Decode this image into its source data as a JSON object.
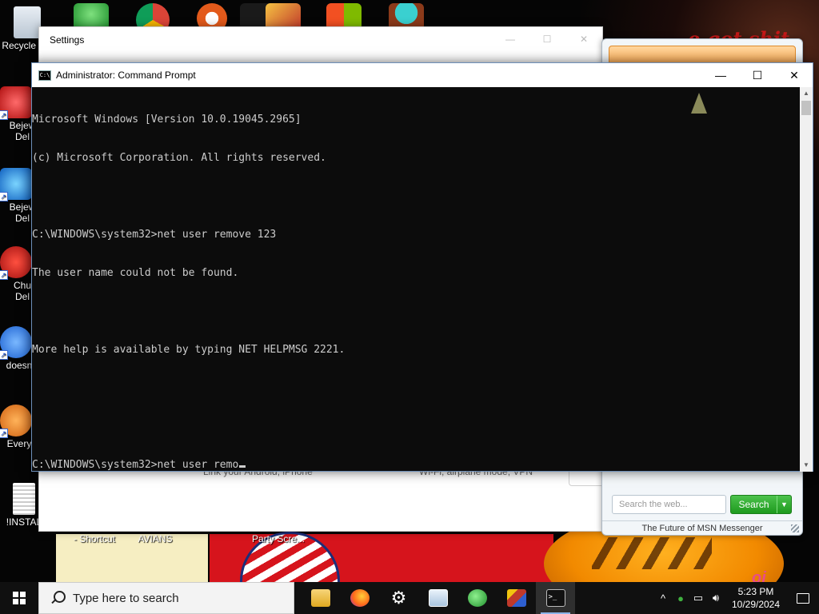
{
  "desktop": {
    "background_text_top": "e got shit",
    "icons": [
      {
        "label": "Recycle Bin",
        "name": "recycle-bin-icon"
      },
      {
        "label": "Bejew Del",
        "name": "bejeweled-icon"
      },
      {
        "label": "Bejew Del",
        "name": "bejeweled-icon"
      },
      {
        "label": "Chu Del",
        "name": "chuzzle-icon"
      },
      {
        "label": "doesn",
        "name": "app-icon"
      },
      {
        "label": "Every",
        "name": "app-icon"
      },
      {
        "label": "!INSTAL",
        "name": "text-file-icon"
      }
    ],
    "bottom_labels": [
      "- Shortcut",
      "AVIANS",
      "Party Scre..."
    ]
  },
  "settings": {
    "title": "Settings",
    "hint_phone": "Link your Android, iPhone",
    "hint_network": "Wi-Fi, airplane mode, VPN"
  },
  "msn": {
    "search_placeholder": "Search the web...",
    "search_button": "Search",
    "footer": "The Future of MSN Messenger"
  },
  "cmd": {
    "title": "Administrator: Command Prompt",
    "lines": [
      "Microsoft Windows [Version 10.0.19045.2965]",
      "(c) Microsoft Corporation. All rights reserved.",
      "",
      "C:\\WINDOWS\\system32>net user remove 123",
      "The user name could not be found.",
      "",
      "More help is available by typing NET HELPMSG 2221.",
      "",
      "",
      "C:\\WINDOWS\\system32>net user remo"
    ]
  },
  "taskbar": {
    "search_placeholder": "Type here to search",
    "apps": [
      {
        "name": "file-explorer-icon",
        "color": "#f2c34c"
      },
      {
        "name": "firefox-icon",
        "color": "#ff7a1a"
      },
      {
        "name": "settings-gear-icon",
        "color": "#ffffff"
      },
      {
        "name": "notepad-icon",
        "color": "#cfe3f5"
      },
      {
        "name": "msn-messenger-icon",
        "color": "#3fb03f"
      },
      {
        "name": "paint-app-icon",
        "color": "#c0392b"
      },
      {
        "name": "command-prompt-icon",
        "color": "#111111"
      }
    ],
    "time": "5:23 PM",
    "date": "10/29/2024"
  }
}
